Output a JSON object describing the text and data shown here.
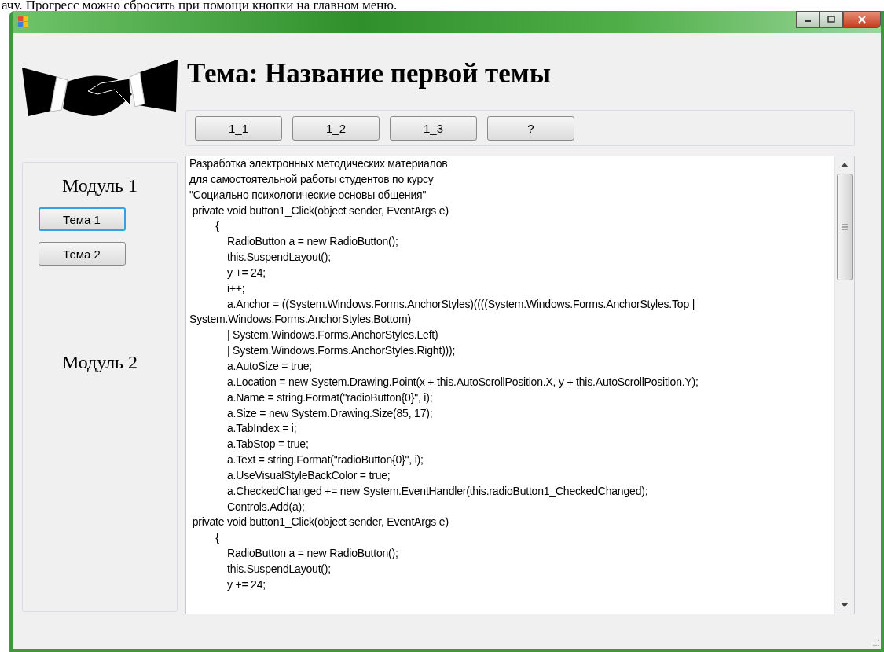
{
  "caption_above": "ачу. Прогресс можно сбросить при помощи кнопки на главном меню.",
  "title": "Тема: Название первой темы",
  "subtopic_buttons": [
    "1_1",
    "1_2",
    "1_3",
    "?"
  ],
  "modules": [
    {
      "title": "Модуль 1",
      "topics": [
        {
          "label": "Тема 1",
          "selected": true
        },
        {
          "label": "Тема 2",
          "selected": false
        }
      ]
    },
    {
      "title": "Модуль 2"
    }
  ],
  "text_lines": [
    "Разработка электронных методических материалов",
    "для самостоятельной работы студентов по курсу",
    "\"Социально психологические основы общения\"",
    " private void button1_Click(object sender, EventArgs e)",
    "         {",
    "             RadioButton a = new RadioButton();",
    "             this.SuspendLayout();",
    "             y += 24;",
    "             i++;",
    "             a.Anchor = ((System.Windows.Forms.AnchorStyles)((((System.Windows.Forms.AnchorStyles.Top |",
    "System.Windows.Forms.AnchorStyles.Bottom)",
    "             | System.Windows.Forms.AnchorStyles.Left)",
    "             | System.Windows.Forms.AnchorStyles.Right)));",
    "             a.AutoSize = true;",
    "             a.Location = new System.Drawing.Point(x + this.AutoScrollPosition.X, y + this.AutoScrollPosition.Y);",
    "             a.Name = string.Format(\"radioButton{0}\", i);",
    "             a.Size = new System.Drawing.Size(85, 17);",
    "             a.TabIndex = i;",
    "             a.TabStop = true;",
    "             a.Text = string.Format(\"radioButton{0}\", i);",
    "             a.UseVisualStyleBackColor = true;",
    "             a.CheckedChanged += new System.EventHandler(this.radioButton1_CheckedChanged);",
    "             Controls.Add(a);",
    " private void button1_Click(object sender, EventArgs e)",
    "         {",
    "             RadioButton a = new RadioButton();",
    "             this.SuspendLayout();",
    "             y += 24;"
  ]
}
